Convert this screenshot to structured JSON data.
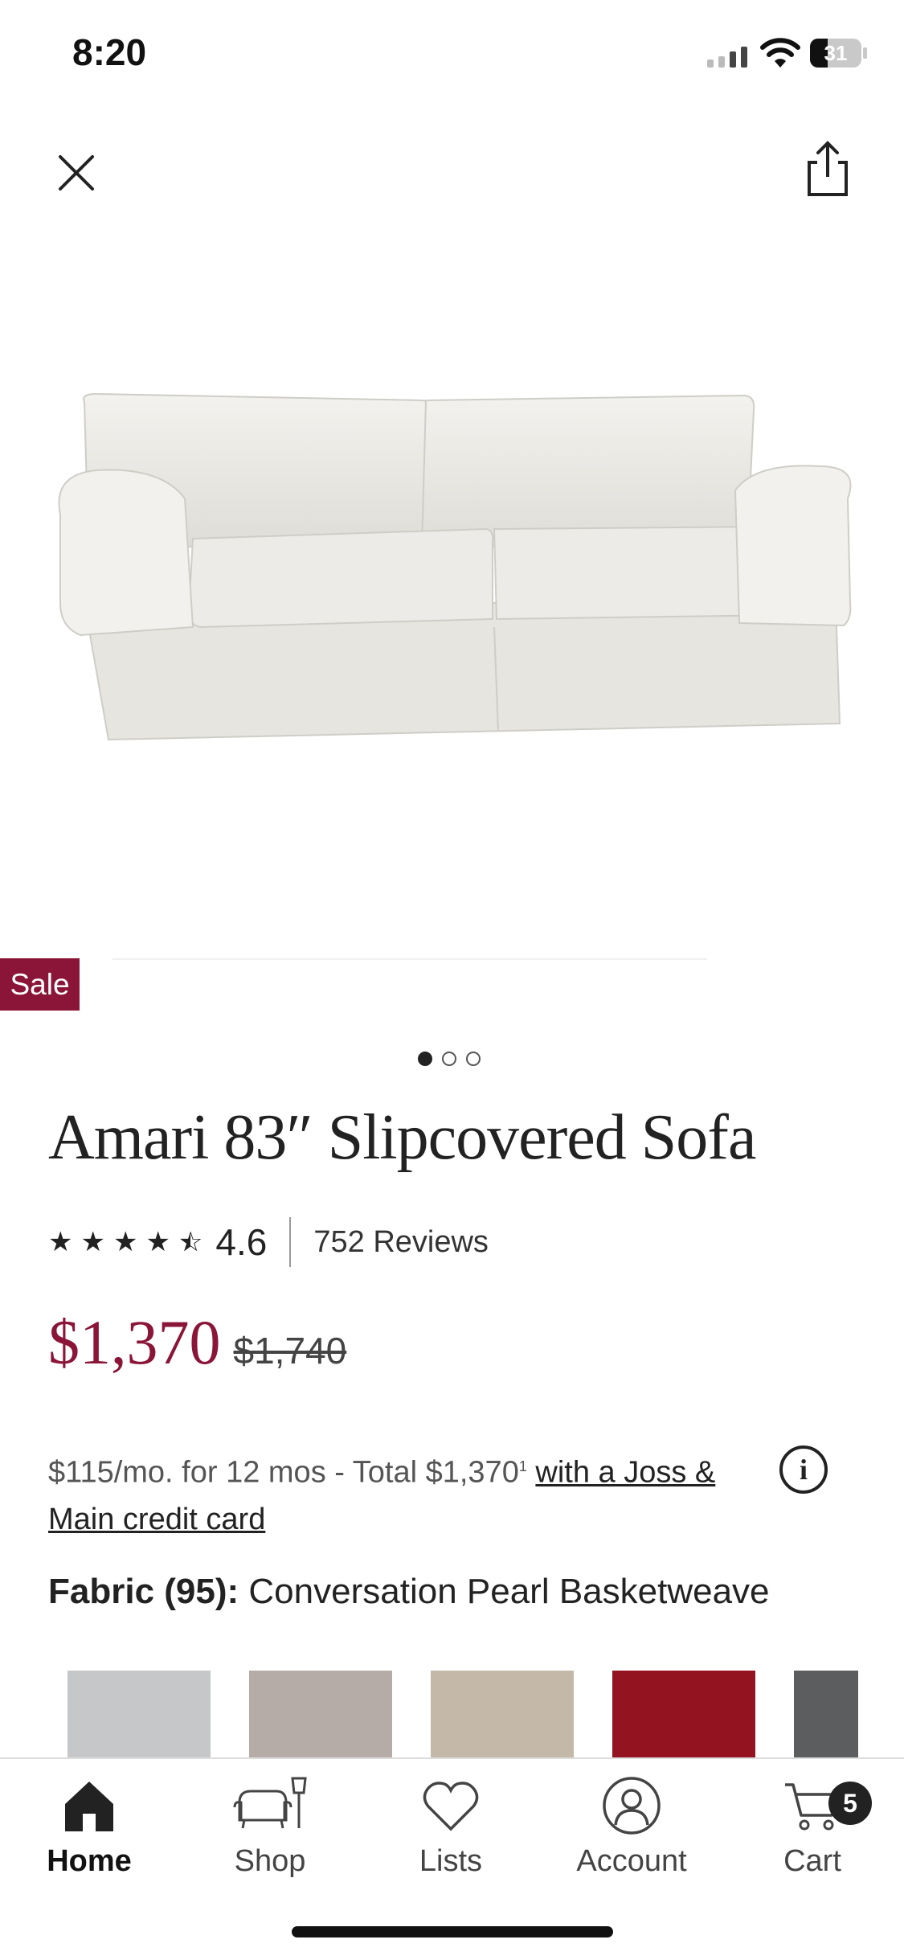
{
  "status_bar": {
    "time": "8:20",
    "battery": "31"
  },
  "product": {
    "sale_label": "Sale",
    "title": "Amari 83″ Slipcovered Sofa",
    "rating": "4.6",
    "rating_stars": 4.6,
    "reviews": "752 Reviews",
    "price": "$1,370",
    "old_price": "$1,740",
    "image_index": 1,
    "image_count": 3
  },
  "financing": {
    "text": "$115/mo. for 12 mos - Total $1,370",
    "superscript": "1",
    "link": "with a Joss & Main credit card"
  },
  "fabric": {
    "label": "Fabric (95):",
    "value": "Conversation Pearl Basketweave",
    "swatches": [
      "#c6c7c8",
      "#b5aba7",
      "#c4b9a8",
      "#931420",
      "#5b5d5e"
    ]
  },
  "tabs": [
    {
      "label": "Home",
      "active": true
    },
    {
      "label": "Shop"
    },
    {
      "label": "Lists"
    },
    {
      "label": "Account"
    },
    {
      "label": "Cart",
      "badge": "5"
    }
  ],
  "colors": {
    "accent": "#8a1538"
  }
}
